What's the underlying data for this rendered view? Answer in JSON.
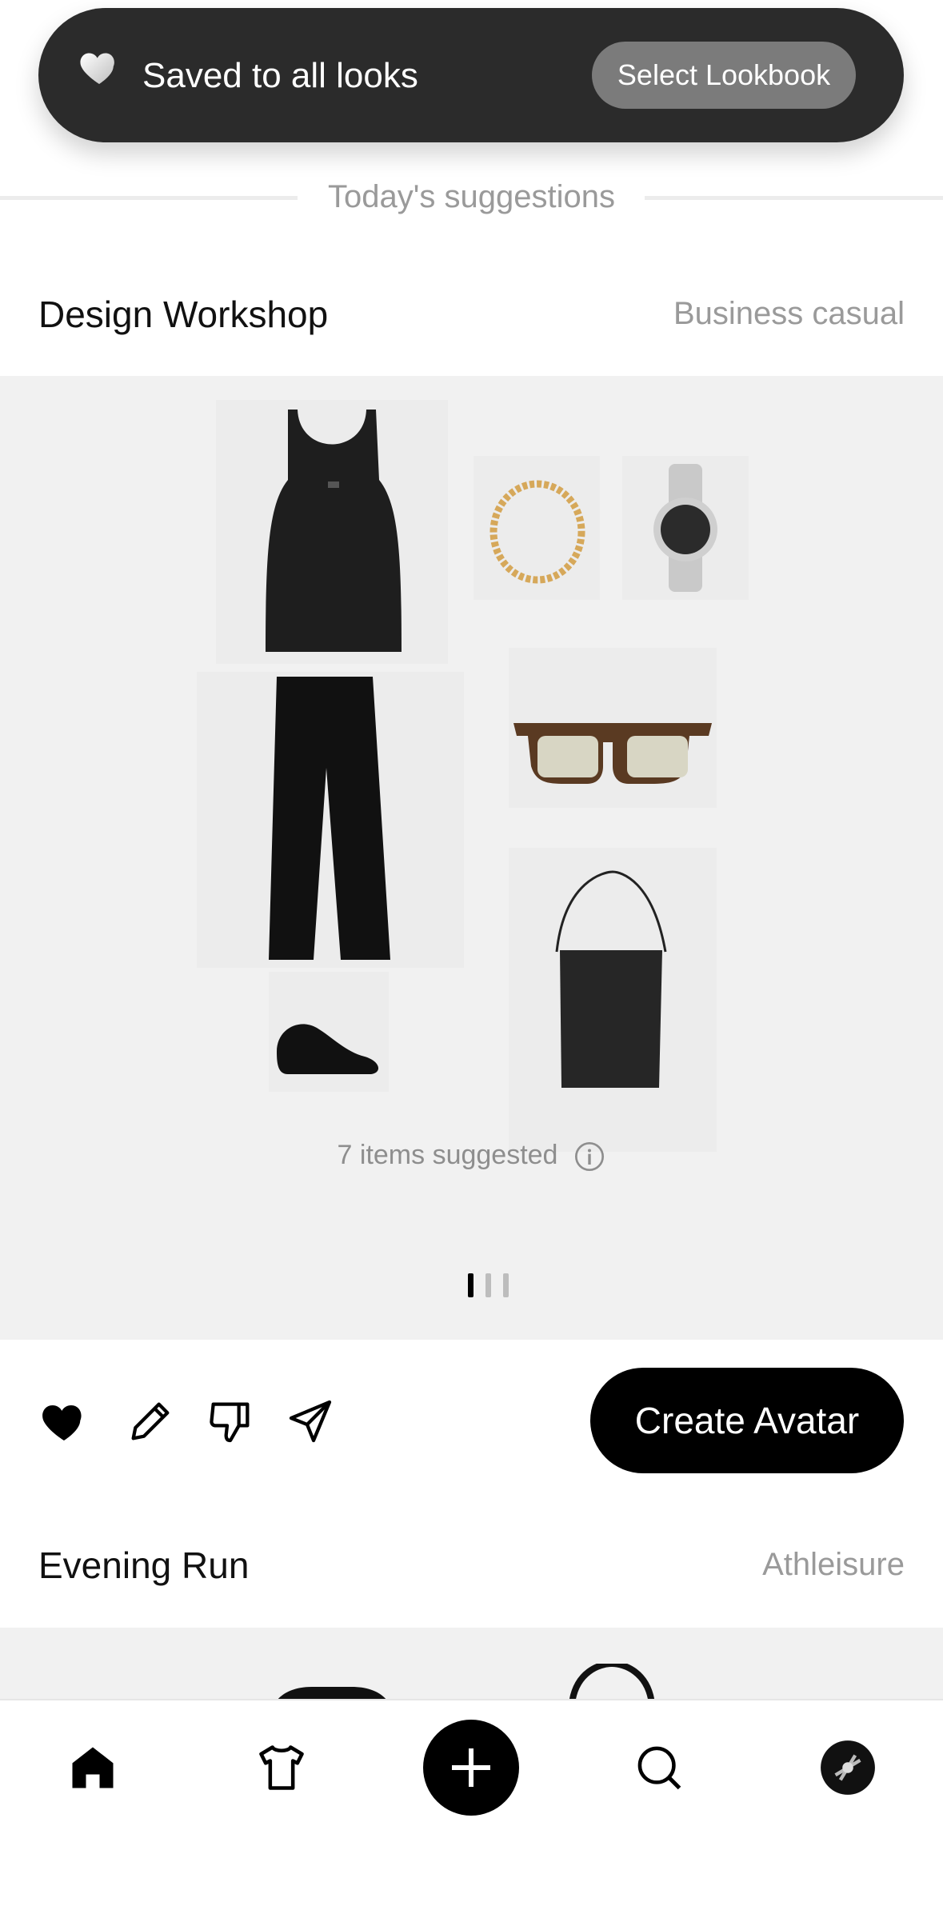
{
  "toast": {
    "message": "Saved to all looks",
    "button_label": "Select Lookbook"
  },
  "suggestions_header": "Today's suggestions",
  "looks": [
    {
      "title": "Design Workshop",
      "style": "Business casual",
      "items": [
        "tank-top",
        "gold-chain-necklace",
        "silver-watch",
        "black-wide-leg-trousers",
        "tortoiseshell-sunglasses",
        "black-tote-bag",
        "black-loafers"
      ],
      "items_summary": "7 items suggested"
    },
    {
      "title": "Evening Run",
      "style": "Athleisure"
    }
  ],
  "actions": {
    "create_avatar_label": "Create Avatar"
  },
  "pager": {
    "count": 3,
    "active_index": 0
  },
  "nav": {
    "items": [
      "home-icon",
      "wardrobe-shirt-icon",
      "add-icon",
      "search-icon",
      "profile-avatar-icon"
    ],
    "active": "home-icon"
  },
  "colors": {
    "toast_bg": "#2b2b2b",
    "toast_button_bg": "#7b7b7b",
    "panel_bg": "#f1f1f1",
    "primary_button_bg": "#000000",
    "muted_text": "#9a9a9a"
  }
}
